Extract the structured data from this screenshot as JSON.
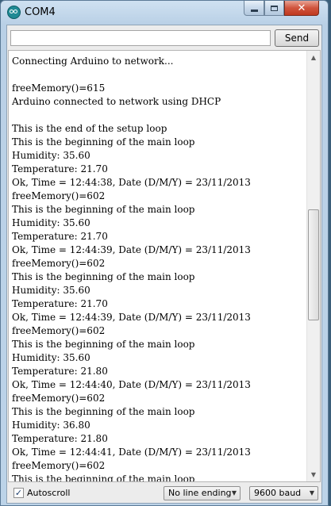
{
  "window": {
    "title": "COM4",
    "icon": "arduino-icon",
    "controls": {
      "minimize_icon": "minimize-icon",
      "maximize_icon": "maximize-icon",
      "close_icon": "close-icon",
      "close_glyph": "✕"
    }
  },
  "input": {
    "value": "",
    "placeholder": ""
  },
  "send_label": "Send",
  "output": {
    "lines": [
      "Connecting Arduino to network...",
      "",
      "freeMemory()=615",
      "Arduino connected to network using DHCP",
      "",
      "This is the end of the setup loop",
      "This is the beginning of the main loop",
      "Humidity: 35.60",
      "Temperature: 21.70",
      "Ok, Time = 12:44:38, Date (D/M/Y) = 23/11/2013",
      "freeMemory()=602",
      "This is the beginning of the main loop",
      "Humidity: 35.60",
      "Temperature: 21.70",
      "Ok, Time = 12:44:39, Date (D/M/Y) = 23/11/2013",
      "freeMemory()=602",
      "This is the beginning of the main loop",
      "Humidity: 35.60",
      "Temperature: 21.70",
      "Ok, Time = 12:44:39, Date (D/M/Y) = 23/11/2013",
      "freeMemory()=602",
      "This is the beginning of the main loop",
      "Humidity: 35.60",
      "Temperature: 21.80",
      "Ok, Time = 12:44:40, Date (D/M/Y) = 23/11/2013",
      "freeMemory()=602",
      "This is the beginning of the main loop",
      "Humidity: 36.80",
      "Temperature: 21.80",
      "Ok, Time = 12:44:41, Date (D/M/Y) = 23/11/2013",
      "freeMemory()=602",
      "This is the beginning of the main loop"
    ]
  },
  "bottom": {
    "autoscroll_label": "Autoscroll",
    "autoscroll_checked": true,
    "check_glyph": "✓",
    "line_ending": "No line ending",
    "baud": "9600 baud"
  },
  "colors": {
    "close_button": "#c03a20",
    "titlebar": "#cfe1f1"
  }
}
